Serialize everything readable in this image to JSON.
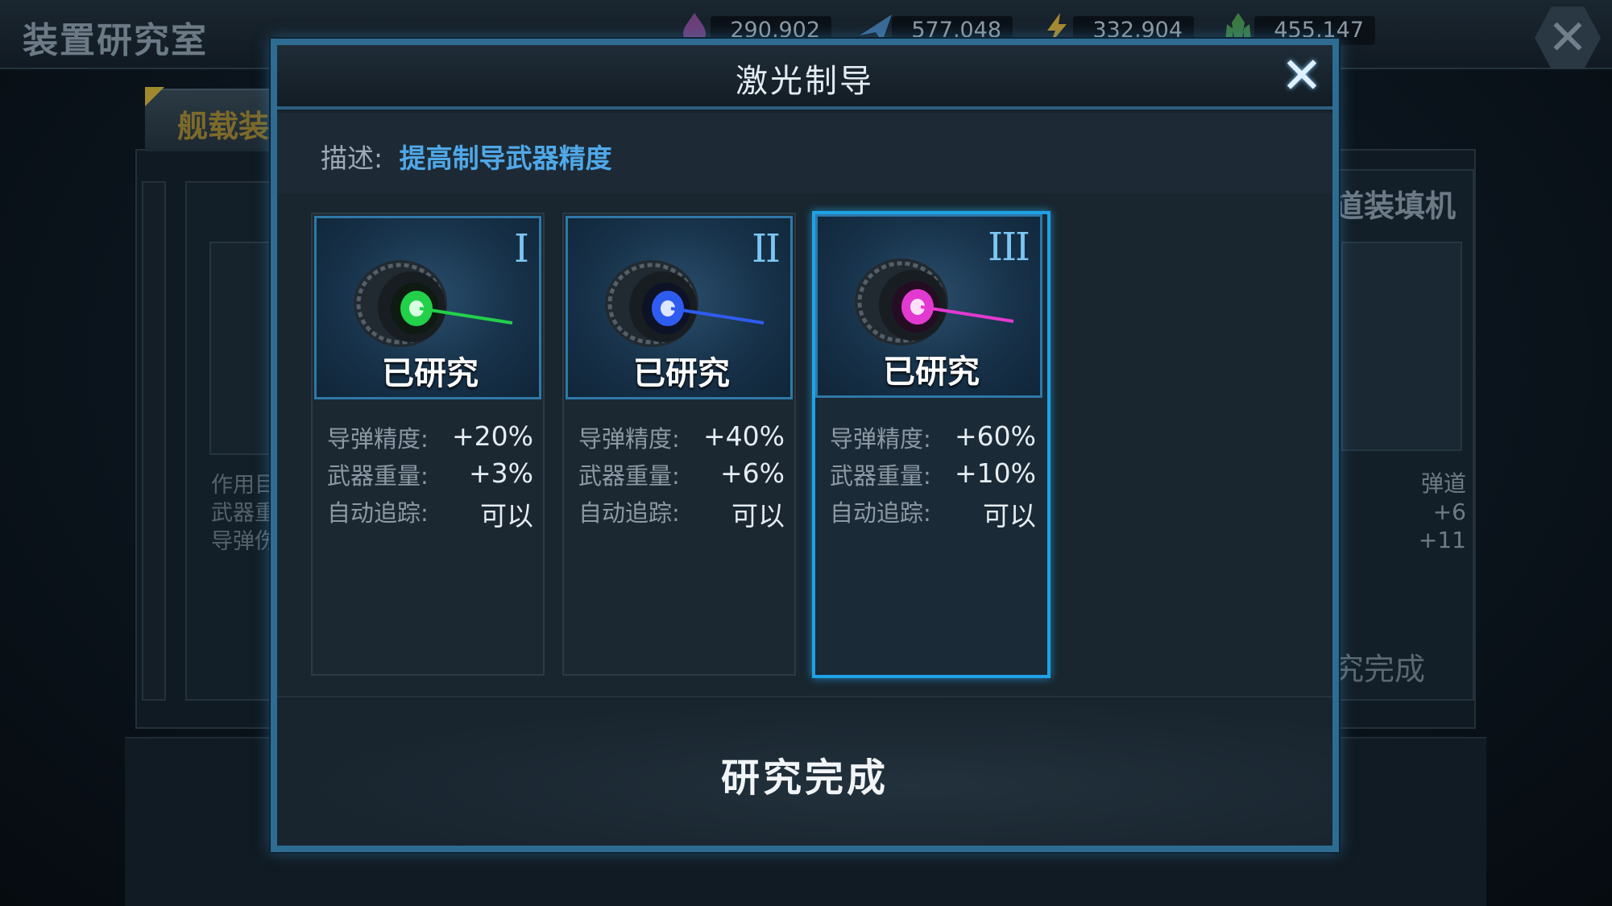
{
  "background": {
    "title": "装置研究室",
    "resources": [
      {
        "icon": "oil-icon",
        "value": "290,902",
        "color": "#8d3f9c"
      },
      {
        "icon": "plane-icon",
        "value": "577,048",
        "color": "#3a78c0"
      },
      {
        "icon": "energy-icon",
        "value": "332,904",
        "color": "#d4a62a"
      },
      {
        "icon": "crystal-icon",
        "value": "455,147",
        "color": "#3fa24a"
      }
    ],
    "tab_label": "舰载装",
    "left_card_lines": [
      "作用目",
      "武器重",
      "导弹伤"
    ],
    "right_card_title": "道装填机",
    "right_card_stats": [
      "弹道",
      "+6",
      "+11"
    ],
    "right_card_status": "究完成"
  },
  "modal": {
    "title": "激光制导",
    "desc_label": "描述:",
    "desc_text": "提高制导武器精度",
    "cards": [
      {
        "tier": "I",
        "status": "已研究",
        "lens_color": "#22d04a",
        "stats": [
          {
            "label": "导弹精度:",
            "value": "+20%"
          },
          {
            "label": "武器重量:",
            "value": "+3%"
          },
          {
            "label": "自动追踪:",
            "value": "可以"
          }
        ]
      },
      {
        "tier": "II",
        "status": "已研究",
        "lens_color": "#2f5cf0",
        "stats": [
          {
            "label": "导弹精度:",
            "value": "+40%"
          },
          {
            "label": "武器重量:",
            "value": "+6%"
          },
          {
            "label": "自动追踪:",
            "value": "可以"
          }
        ]
      },
      {
        "tier": "III",
        "status": "已研究",
        "lens_color": "#e23ad0",
        "stats": [
          {
            "label": "导弹精度:",
            "value": "+60%"
          },
          {
            "label": "武器重量:",
            "value": "+10%"
          },
          {
            "label": "自动追踪:",
            "value": "可以"
          }
        ]
      }
    ],
    "footer": "研究完成",
    "accent_color": "#1fa2e6"
  }
}
